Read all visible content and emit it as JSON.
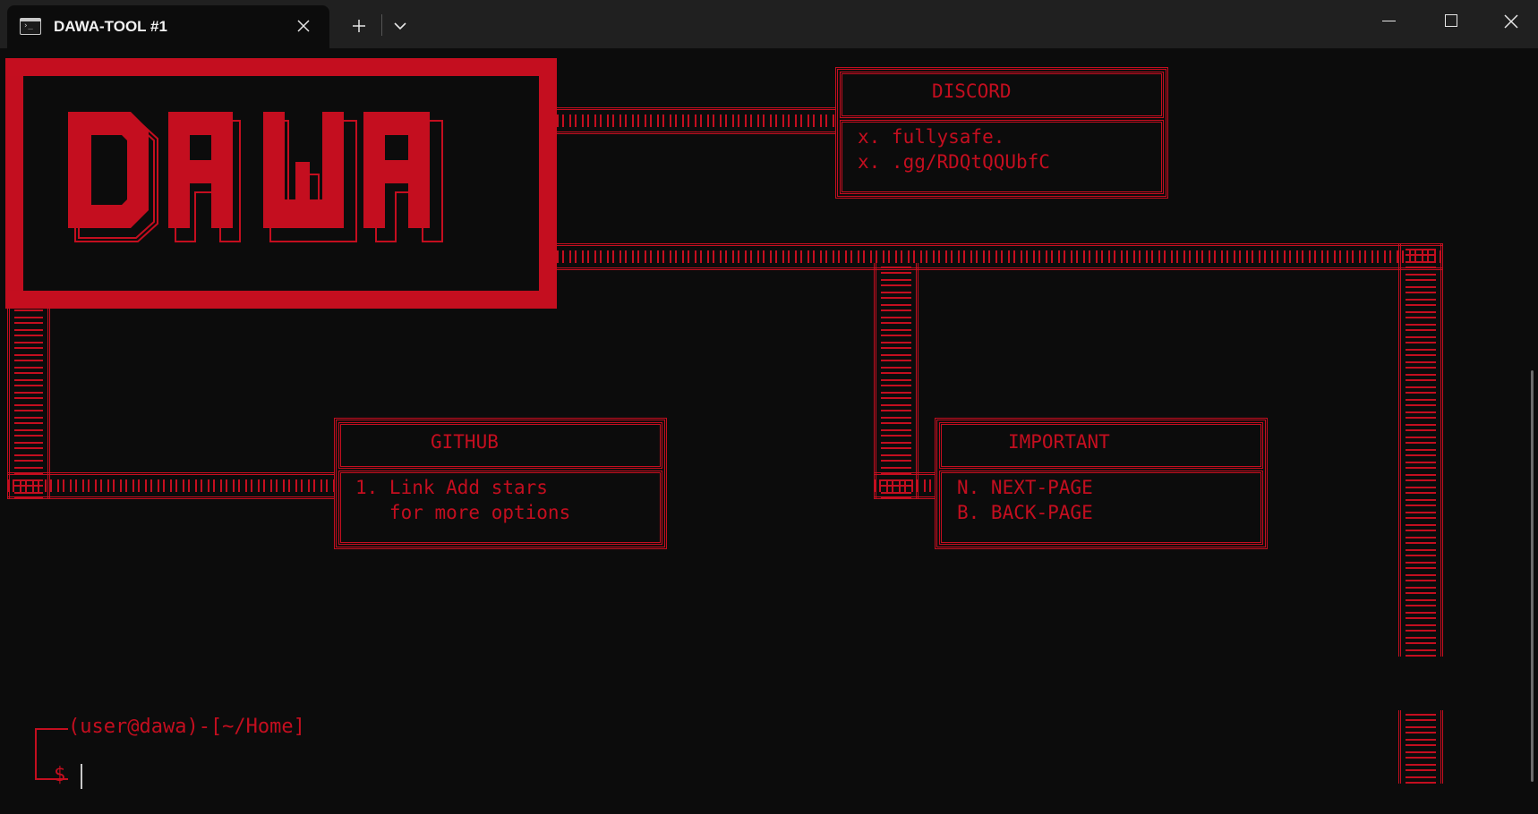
{
  "window": {
    "tab_title": "DAWA-TOOL #1",
    "icons": {
      "tab": "terminal-icon",
      "close_tab": "close-icon",
      "new_tab": "plus-icon",
      "dropdown": "chevron-down-icon",
      "minimize": "minimize-icon",
      "maximize": "maximize-icon",
      "close_window": "close-icon"
    }
  },
  "colors": {
    "accent": "#c40e1f",
    "background": "#0c0c0c",
    "titlebar": "#202020"
  },
  "banner": {
    "logo_text": "DAWA"
  },
  "discord": {
    "title": "DISCORD",
    "lines": [
      "x. fullysafe.",
      "x. .gg/RDQtQQUbfC"
    ]
  },
  "github": {
    "title": "GITHUB",
    "lines": [
      "1. Link Add stars",
      "   for more options"
    ]
  },
  "important": {
    "title": "IMPORTANT",
    "lines": [
      "N. NEXT-PAGE",
      "B. BACK-PAGE"
    ]
  },
  "prompt": {
    "line1": "(user@dawa)-[~/Home]",
    "line2": "$"
  }
}
